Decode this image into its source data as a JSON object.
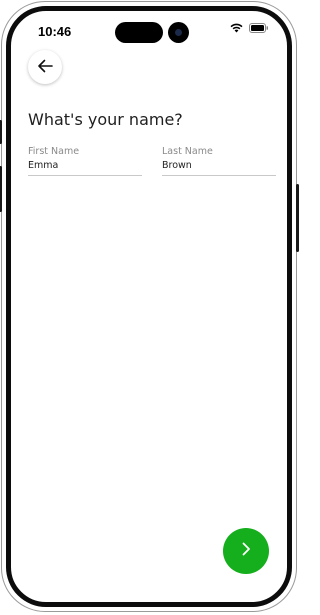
{
  "status_bar": {
    "time": "10:46",
    "wifi_icon": "wifi-icon",
    "battery_icon": "battery-icon"
  },
  "nav": {
    "back_icon": "arrow-left-icon"
  },
  "form": {
    "title": "What's your name?",
    "first_name": {
      "label": "First Name",
      "value": "Emma"
    },
    "last_name": {
      "label": "Last Name",
      "value": "Brown"
    }
  },
  "footer": {
    "next_icon": "chevron-right-icon",
    "accent_color": "#15ae1c"
  }
}
